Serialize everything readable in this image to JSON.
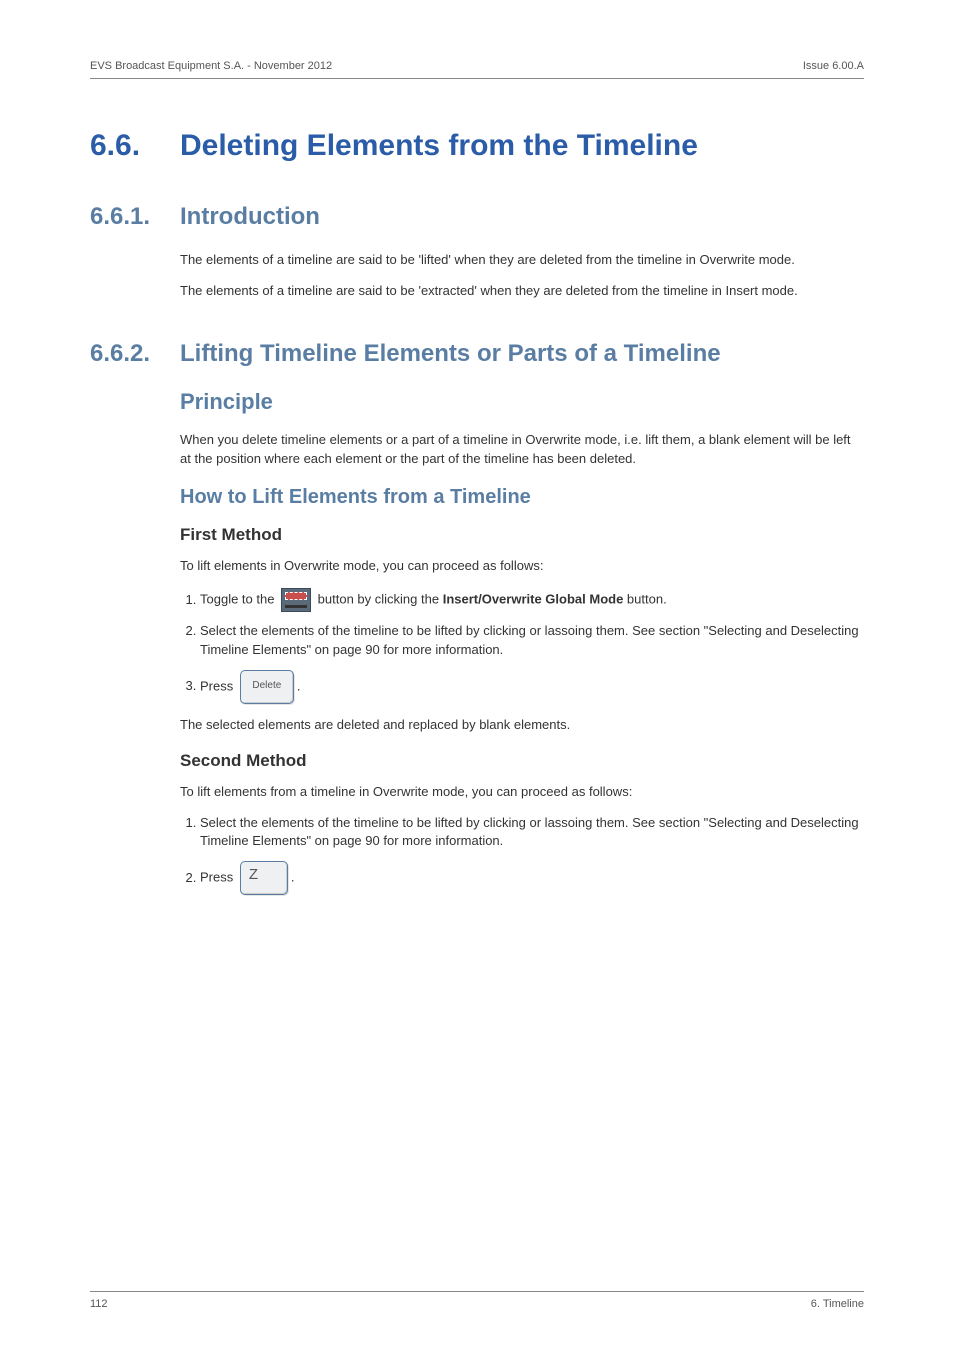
{
  "header": {
    "left": "EVS Broadcast Equipment S.A. - November 2012",
    "right": "Issue 6.00.A"
  },
  "h1": {
    "num": "6.6.",
    "title": "Deleting Elements from the Timeline"
  },
  "intro": {
    "num": "6.6.1.",
    "title": "Introduction",
    "p1": "The elements of a timeline are said to be 'lifted' when they are deleted from the timeline in Overwrite mode.",
    "p2": "The elements of a timeline are said to be 'extracted' when they are deleted from the timeline in Insert mode."
  },
  "lifting": {
    "num": "6.6.2.",
    "title": "Lifting Timeline Elements or Parts of a Timeline",
    "principle_heading": "Principle",
    "principle_text": "When you delete timeline elements or a part of a timeline in Overwrite mode, i.e. lift them, a blank element will be left at the position where each element or the part of the timeline has been deleted.",
    "howto_heading": "How to Lift Elements from a Timeline",
    "first_method": {
      "heading": "First Method",
      "intro": "To lift elements in Overwrite mode, you can proceed as follows:",
      "step1_prefix": "Toggle to the ",
      "step1_mid": " button by clicking the ",
      "step1_bold": "Insert/Overwrite Global Mode",
      "step1_suffix": " button.",
      "step2": "Select the elements of the timeline to be lifted by clicking or lassoing them. See section \"Selecting and Deselecting Timeline Elements\" on page 90 for more information.",
      "step3_prefix": "Press ",
      "step3_key": "Delete",
      "step3_suffix": ".",
      "result": "The selected elements are deleted and replaced by blank elements."
    },
    "second_method": {
      "heading": "Second Method",
      "intro": "To lift elements from a timeline in Overwrite mode, you can proceed as follows:",
      "step1": "Select the elements of the timeline to be lifted by clicking or lassoing them. See section \"Selecting and Deselecting Timeline Elements\" on page 90 for more information.",
      "step2_prefix": "Press ",
      "step2_key": "Z",
      "step2_suffix": "."
    }
  },
  "footer": {
    "left": "112",
    "right": "6. Timeline"
  }
}
